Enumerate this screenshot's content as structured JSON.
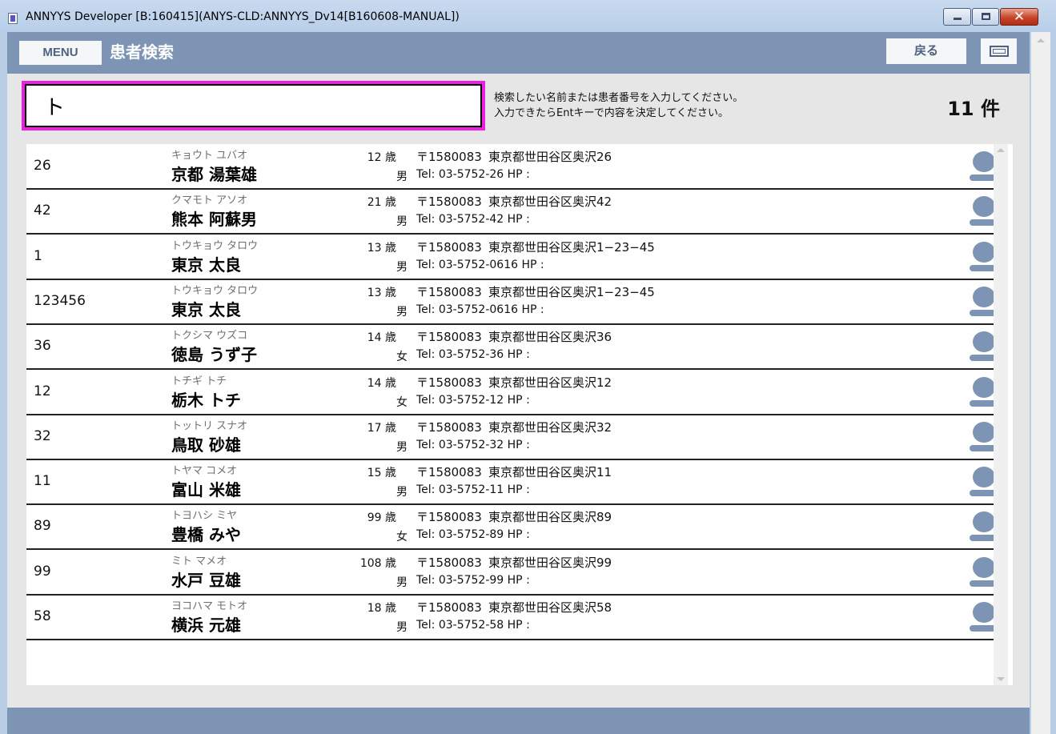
{
  "window": {
    "title": "ANNYYS Developer [B:160415](ANYS-CLD:ANNYYS_Dv14[B160608-MANUAL])",
    "close_label": "✕"
  },
  "header": {
    "menu_label": "MENU",
    "title": "患者検索",
    "back_label": "戻る"
  },
  "search": {
    "value": "ト",
    "hint_line1": "検索したい名前または患者番号を入力してください。",
    "hint_line2": "入力できたらEntキーで内容を決定してください。"
  },
  "result_count": "11 件",
  "colors": {
    "header": "#7d94b4",
    "search_border": "#ee1fe5",
    "avatar": "#7d94b4"
  },
  "patients": [
    {
      "id": "26",
      "kana": "キョウト ユバオ",
      "name": "京都 湯葉雄",
      "age": "12 歳",
      "sex": "男",
      "zip": "〒1580083",
      "address": "東京都世田谷区奥沢26",
      "tel": "Tel: 03-5752-26  HP :"
    },
    {
      "id": "42",
      "kana": "クマモト アソオ",
      "name": "熊本 阿蘇男",
      "age": "21 歳",
      "sex": "男",
      "zip": "〒1580083",
      "address": "東京都世田谷区奥沢42",
      "tel": "Tel: 03-5752-42  HP :"
    },
    {
      "id": "1",
      "kana": "トウキョウ タロウ",
      "name": "東京 太良",
      "age": "13 歳",
      "sex": "男",
      "zip": "〒1580083",
      "address": "東京都世田谷区奥沢1−23−45",
      "tel": "Tel: 03-5752-0616  HP :"
    },
    {
      "id": "123456",
      "kana": "トウキョウ タロウ",
      "name": "東京 太良",
      "age": "13 歳",
      "sex": "男",
      "zip": "〒1580083",
      "address": "東京都世田谷区奥沢1−23−45",
      "tel": "Tel: 03-5752-0616  HP :"
    },
    {
      "id": "36",
      "kana": "トクシマ ウズコ",
      "name": "徳島 うず子",
      "age": "14 歳",
      "sex": "女",
      "zip": "〒1580083",
      "address": "東京都世田谷区奥沢36",
      "tel": "Tel: 03-5752-36  HP :"
    },
    {
      "id": "12",
      "kana": "トチギ トチ",
      "name": "栃木 トチ",
      "age": "14 歳",
      "sex": "女",
      "zip": "〒1580083",
      "address": "東京都世田谷区奥沢12",
      "tel": "Tel: 03-5752-12  HP :"
    },
    {
      "id": "32",
      "kana": "トットリ スナオ",
      "name": "鳥取 砂雄",
      "age": "17 歳",
      "sex": "男",
      "zip": "〒1580083",
      "address": "東京都世田谷区奥沢32",
      "tel": "Tel: 03-5752-32  HP :"
    },
    {
      "id": "11",
      "kana": "トヤマ コメオ",
      "name": "富山 米雄",
      "age": "15 歳",
      "sex": "男",
      "zip": "〒1580083",
      "address": "東京都世田谷区奥沢11",
      "tel": "Tel: 03-5752-11  HP :"
    },
    {
      "id": "89",
      "kana": "トヨハシ ミヤ",
      "name": "豊橋 みや",
      "age": "99 歳",
      "sex": "女",
      "zip": "〒1580083",
      "address": "東京都世田谷区奥沢89",
      "tel": "Tel: 03-5752-89  HP :"
    },
    {
      "id": "99",
      "kana": "ミト マメオ",
      "name": "水戸 豆雄",
      "age": "108 歳",
      "sex": "男",
      "zip": "〒1580083",
      "address": "東京都世田谷区奥沢99",
      "tel": "Tel: 03-5752-99  HP :"
    },
    {
      "id": "58",
      "kana": "ヨコハマ モトオ",
      "name": "横浜 元雄",
      "age": "18 歳",
      "sex": "男",
      "zip": "〒1580083",
      "address": "東京都世田谷区奥沢58",
      "tel": "Tel: 03-5752-58  HP :"
    }
  ]
}
